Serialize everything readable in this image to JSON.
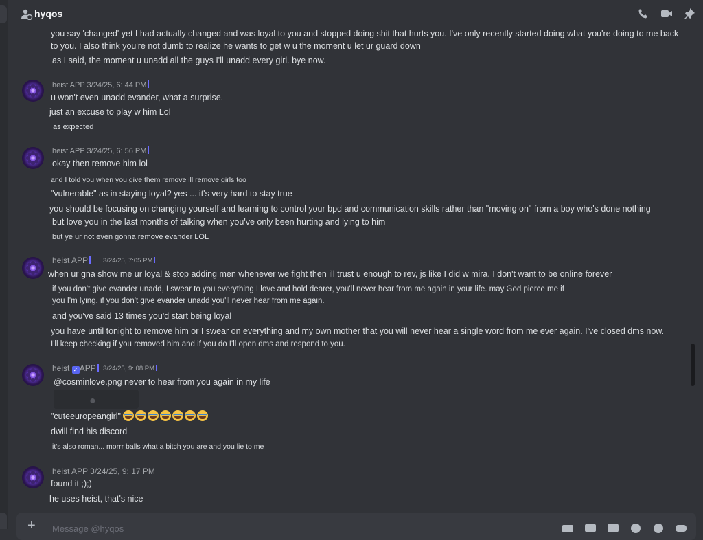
{
  "header": {
    "title": "hyqos",
    "icons": [
      "people-icon",
      "phone-icon",
      "video-icon",
      "pin-icon"
    ]
  },
  "messages": {
    "cont1_a": "you say 'changed' yet I had actually changed and was loyal to you and stopped doing shit that hurts you. I've only recently started doing what you're doing to me back",
    "cont1_b": "to you. I also think you're not dumb to realize he wants to get w u the moment u let ur guard down",
    "cont1_c": "as I said, the moment u unadd all the guys I'll unadd every girl. bye now.",
    "g1_meta": "heist APP 3/24/25, 6: 44 PM",
    "g1_l1": "u won't even unadd evander, what a surprise.",
    "g1_l2": "just an excuse to play w him Lol",
    "g1_l3": "as expected",
    "g2_meta": "heist APP 3/24/25, 6: 56 PM",
    "g2_l1": "okay then remove him lol",
    "g2_l2": "and I told you when you give them remove ill remove girls too",
    "g2_l3": "\"vulnerable\" as in staying loyal? yes ... it's very hard to stay true",
    "g2_l4": "you should be focusing on changing yourself and learning to control your bpd and communication skills rather than \"moving on\" from a boy who's done nothing",
    "g2_l5": "but love you in the last months of talking when you've only been hurting and lying to him",
    "g2_l6": "but ye ur not even gonna remove evander LOL",
    "g3_name": "heist APP",
    "g3_time": "3/24/25, 7:05 PM",
    "g3_l1": "when ur gna show me ur loyal & stop adding men whenever we fight then ill trust u enough to rev, js like I did w mira. I don't want to be online forever",
    "g3_l2a": "if you don't give evander unadd, I swear to you everything I love and hold dearer, you'll never hear from me again in your life. may God pierce me if",
    "g3_l2b": "you I'm lying. if you don't give evander unadd you'll never hear from me again.",
    "g3_l3": "and you've said 13 times you'd start being loyal",
    "g3_l4a": "you have until tonight to remove him or I swear on everything and my own mother that you will never hear a single word from me ever again. I've closed dms now.",
    "g3_l4b": "I'll keep checking if you removed him and if you do I'll open dms and respond to you.",
    "g4_name": "heist",
    "g4_app": "APP",
    "g4_time": "3/24/25, 9: 08 PM",
    "g4_l1": "@cosminlove.png never to hear from you again in my life",
    "g4_l2": "\"cuteeuropeangirl\"",
    "g4_l3": "dwill find his discord",
    "g4_l4": "it's also roman... morrr balls what a bitch you are and you lie to me",
    "g5_meta": "heist APP 3/24/25, 9: 17 PM",
    "g5_l1": "found it ;);)",
    "g5_l2": "he uses heist, that's nice"
  },
  "composer": {
    "placeholder": "Message @hyqos",
    "icons": [
      "plus-icon",
      "gift-icon",
      "gif-icon",
      "sticker-icon",
      "emoji-icon",
      "apps-icon"
    ]
  },
  "emoji_count": 7,
  "colors": {
    "bg": "#313338",
    "text": "#dbdee1",
    "muted": "#a3a6aa",
    "accent": "#5865f2"
  }
}
